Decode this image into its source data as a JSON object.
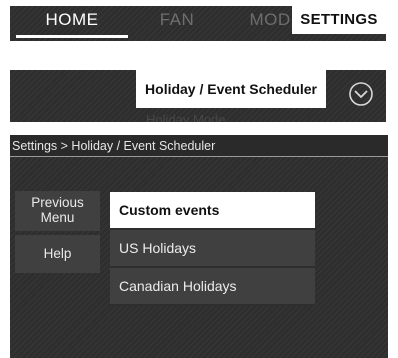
{
  "tabs": [
    {
      "label": "HOME"
    },
    {
      "label": "FAN"
    },
    {
      "label": "MODE"
    },
    {
      "label": "SETTINGS"
    }
  ],
  "menu": {
    "selected_option": "Holiday / Event Scheduler",
    "next_option_partial": "Holiday Mode"
  },
  "breadcrumb": "Settings > Holiday / Event Scheduler",
  "side_buttons": {
    "previous_menu": "Previous\nMenu",
    "help": "Help"
  },
  "list": {
    "items": [
      "Custom events",
      "US Holidays",
      "Canadian Holidays"
    ],
    "selected": "Custom events"
  },
  "colors": {
    "screen_bg": "#2e2e2e",
    "button_bg": "#404040",
    "highlight": "#ffffff"
  },
  "icons": {
    "dropdown": "chevron-down-circle-icon"
  }
}
